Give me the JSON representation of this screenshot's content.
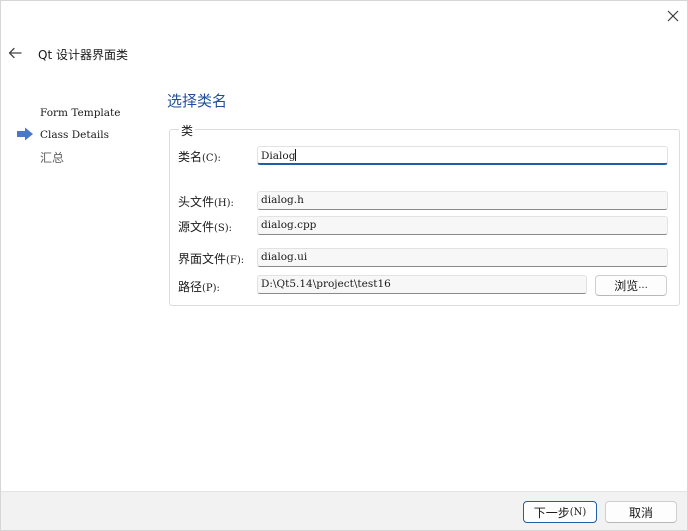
{
  "window": {
    "title": "Qt 设计器界面类",
    "back_icon": "arrow-left-icon",
    "close_icon": "close-icon"
  },
  "steps": [
    {
      "label": "Form Template",
      "active": false
    },
    {
      "label": "Class Details",
      "active": true
    },
    {
      "label": "汇总",
      "active": false
    }
  ],
  "page": {
    "title": "选择类名"
  },
  "group": {
    "title": "类",
    "fields": {
      "class_name": {
        "label_cn": "类名",
        "label_key": "(C):",
        "value": "Dialog"
      },
      "header_file": {
        "label_cn": "头文件",
        "label_key": "(H):",
        "value": "dialog.h"
      },
      "source_file": {
        "label_cn": "源文件",
        "label_key": "(S):",
        "value": "dialog.cpp"
      },
      "form_file": {
        "label_cn": "界面文件",
        "label_key": "(F):",
        "value": "dialog.ui"
      },
      "path": {
        "label_cn": "路径",
        "label_key": "(P):",
        "value": "D:\\Qt5.14\\project\\test16"
      }
    },
    "browse_button": {
      "label_cn": "浏览",
      "label_suffix": "..."
    }
  },
  "footer": {
    "next_button": {
      "label_cn": "下一步",
      "label_key": "(N)"
    },
    "cancel_button": {
      "label": "取消"
    }
  },
  "colors": {
    "accent": "#1f5fa8",
    "title_blue": "#1f4e9c",
    "step_arrow": "#4a78c8",
    "footer_bg": "#f2f2f2"
  }
}
